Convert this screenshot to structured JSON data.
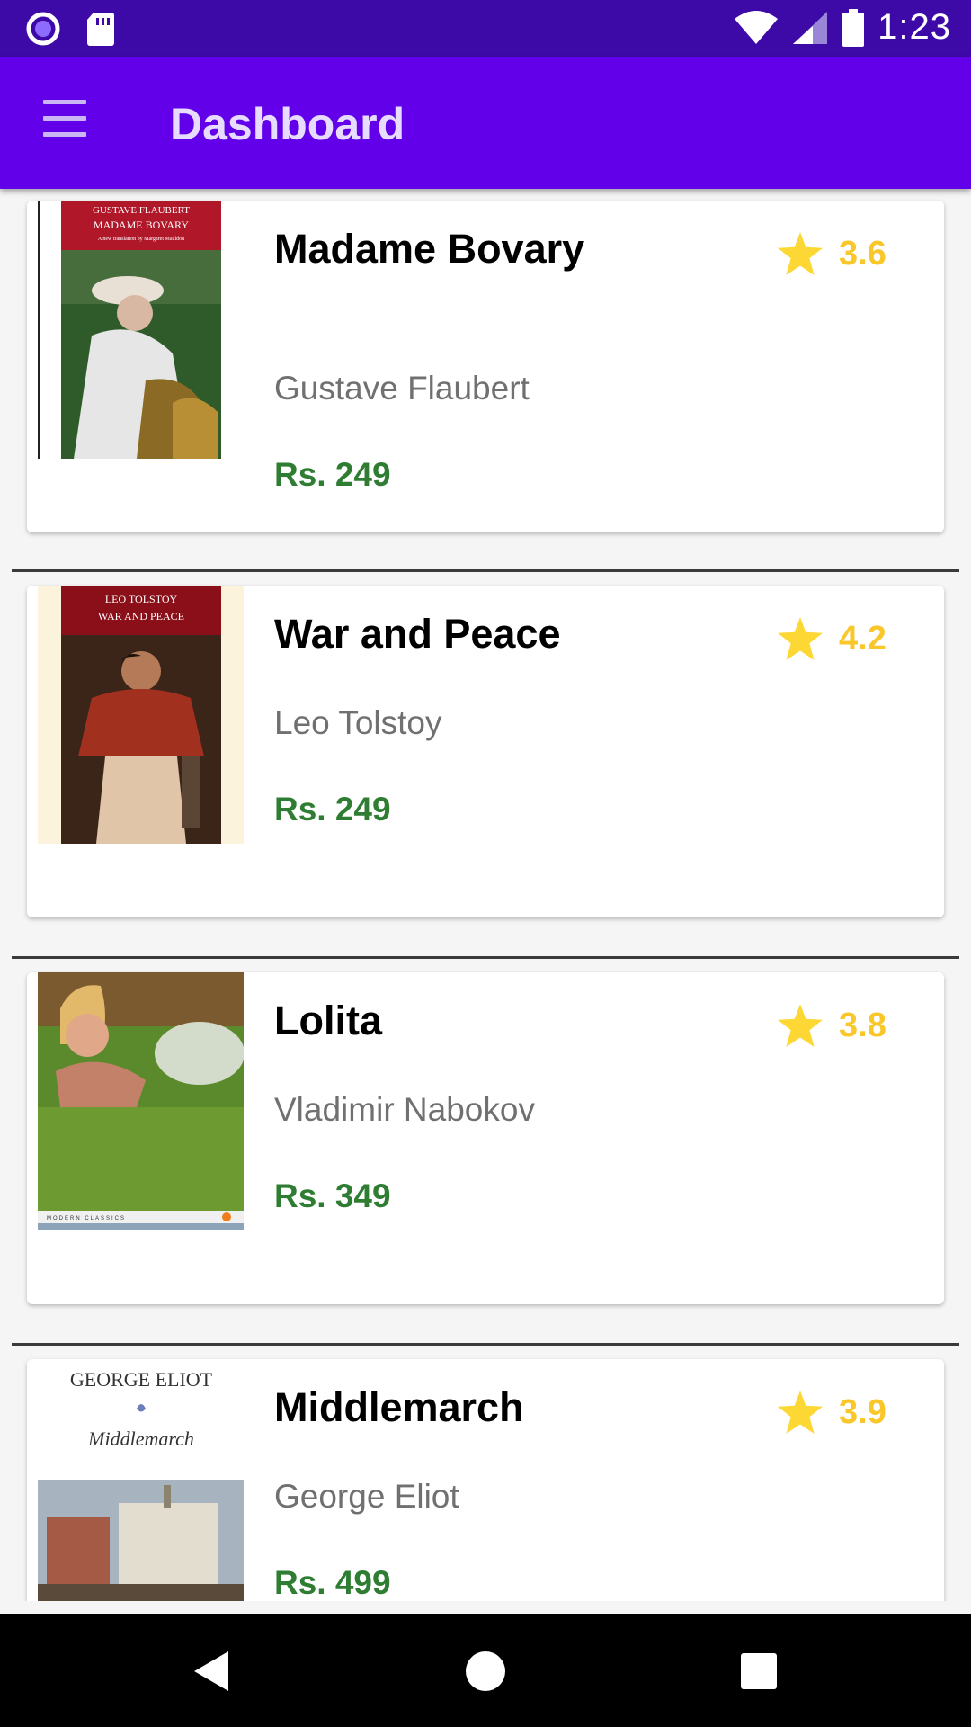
{
  "status_bar": {
    "time": "1:23",
    "left_icons": [
      "circle-icon",
      "sd-card-icon"
    ],
    "right_icons": [
      "wifi-icon",
      "signal-icon",
      "battery-icon"
    ]
  },
  "app_bar": {
    "title": "Dashboard",
    "menu_icon": "hamburger-menu-icon"
  },
  "books": [
    {
      "title": "Madame Bovary",
      "author": "Gustave Flaubert",
      "price": "Rs. 249",
      "rating": "3.6",
      "cover_header": [
        "GUSTAVE FLAUBERT",
        "MADAME BOVARY",
        "A new translation by Margaret Mauldon"
      ]
    },
    {
      "title": "War and Peace",
      "author": "Leo Tolstoy",
      "price": "Rs. 249",
      "rating": "4.2",
      "cover_header": [
        "LEO TOLSTOY",
        "WAR AND PEACE"
      ]
    },
    {
      "title": "Lolita",
      "author": "Vladimir Nabokov",
      "price": "Rs. 349",
      "rating": "3.8",
      "cover_header": [
        "MODERN CLASSICS"
      ]
    },
    {
      "title": "Middlemarch",
      "author": "George Eliot",
      "price": "Rs. 499",
      "rating": "3.9",
      "cover_header": [
        "GEORGE ELIOT",
        "Middlemarch"
      ]
    }
  ],
  "colors": {
    "status_bar": "#3d0aa8",
    "app_bar": "#6200ea",
    "price": "#2e7d32",
    "rating": "#f9c72a"
  },
  "nav_bar": {
    "icons": [
      "back-icon",
      "home-icon",
      "recents-icon"
    ]
  }
}
